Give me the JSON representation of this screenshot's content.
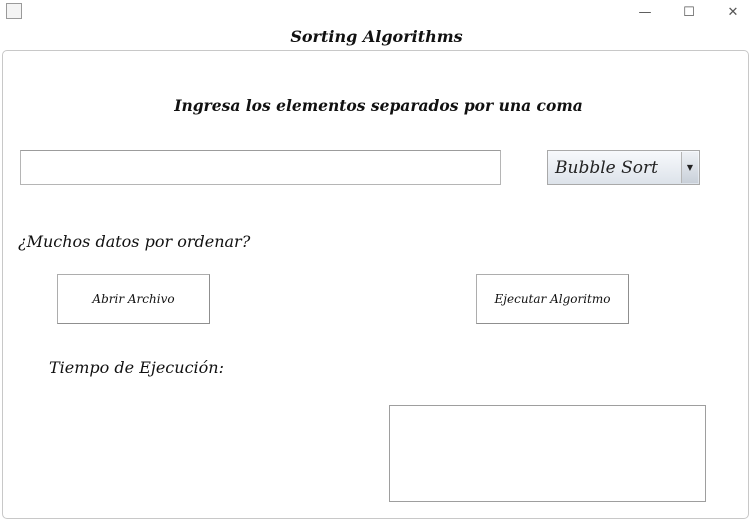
{
  "window": {
    "app_icon": "java-cup-icon",
    "minimize_glyph": "—",
    "maximize_glyph": "☐",
    "close_glyph": "✕"
  },
  "header": {
    "title": "Sorting Algorithms"
  },
  "main": {
    "heading": "Ingresa los elementos separados por una coma",
    "input": {
      "value": "",
      "placeholder": ""
    },
    "algorithm_select": {
      "selected": "Bubble Sort",
      "arrow_icon": "chevron-down-icon"
    },
    "question": "¿Muchos datos por ordenar?",
    "open_file_label": "Abrir Archivo",
    "run_label": "Ejecutar Algoritmo",
    "time_label": "Tiempo de Ejecución:",
    "output": ""
  }
}
